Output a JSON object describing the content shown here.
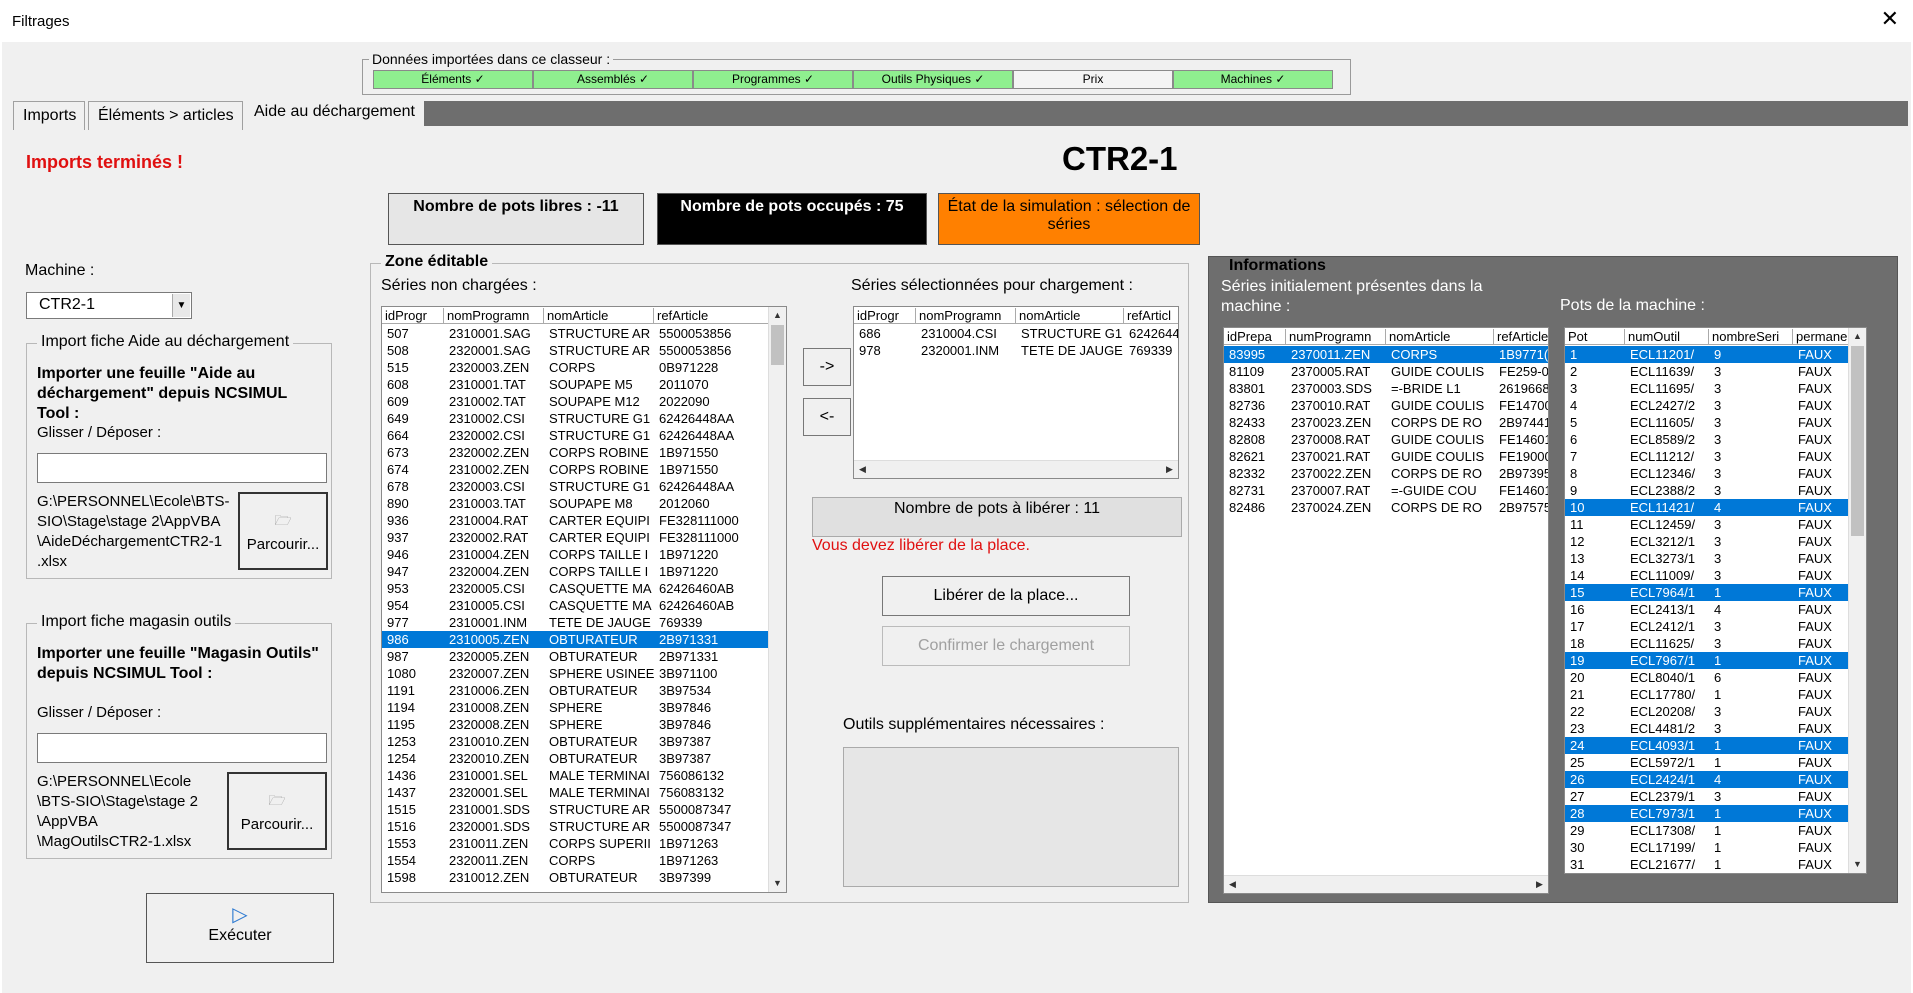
{
  "window": {
    "title": "Filtrages",
    "close": "✕"
  },
  "imported": {
    "label": "Données importées dans ce classeur :",
    "items": [
      {
        "label": "Éléments ✓",
        "color": "#8fef8f"
      },
      {
        "label": "Assemblés ✓",
        "color": "#8fef8f"
      },
      {
        "label": "Programmes ✓",
        "color": "#8fef8f"
      },
      {
        "label": "Outils Physiques ✓",
        "color": "#8fef8f"
      },
      {
        "label": "Prix",
        "color": "#f4f4f4"
      },
      {
        "label": "Machines ✓",
        "color": "#8fef8f"
      }
    ]
  },
  "tabs": [
    "Imports",
    "Éléments > articles",
    "Aide au déchargement"
  ],
  "status_msg": "Imports terminés !",
  "machine_name": "CTR2-1",
  "status": {
    "free": "Nombre de pots libres : -11",
    "occupied": "Nombre de pots occupés : 75",
    "simulation": "État de la simulation : sélection de séries"
  },
  "machine": {
    "label": "Machine :",
    "value": "CTR2-1"
  },
  "import_aide": {
    "title": "Import fiche Aide au déchargement",
    "heading": "Importer une feuille \"Aide au déchargement\" depuis NCSIMUL Tool :",
    "drop_label": "Glisser / Déposer :",
    "path": "G:\\PERSONNEL\\Ecole\\BTS-SIO\\Stage\\stage 2\\AppVBA\\AideDéchargementCTR2-1.xlsx",
    "path_lines": [
      "G:\\PERSONNEL\\Ecole\\BTS-",
      "SIO\\Stage\\stage 2\\AppVBA",
      "\\AideDéchargementCTR2-1",
      ".xlsx"
    ],
    "browse": "Parcourir..."
  },
  "import_mag": {
    "title": "Import fiche magasin outils",
    "heading": "Importer une feuille \"Magasin Outils\" depuis NCSIMUL Tool :",
    "drop_label": "Glisser / Déposer :",
    "path_lines": [
      "G:\\PERSONNEL\\Ecole",
      "\\BTS-SIO\\Stage\\stage 2",
      "\\AppVBA",
      "\\MagOutilsCTR2-1.xlsx"
    ],
    "browse": "Parcourir..."
  },
  "execute": "Exécuter",
  "zone": {
    "title": "Zone éditable",
    "unloaded_label": "Séries non chargées :",
    "selected_label": "Séries sélectionnées pour chargement :",
    "btn_add": "->",
    "btn_remove": "<-",
    "pots_to_free": "Nombre de pots à libérer : 11",
    "warning": "Vous devez libérer de la place.",
    "free_btn": "Libérer de la place...",
    "confirm_btn": "Confirmer le chargement",
    "extra_tools_label": "Outils supplémentaires nécessaires :"
  },
  "unloaded": {
    "headers": [
      "idProgr",
      "nomProgramn",
      "nomArticle",
      "refArticle"
    ],
    "rows": [
      [
        "507",
        "2310001.SAG",
        "STRUCTURE AR",
        "5500053856"
      ],
      [
        "508",
        "2320001.SAG",
        "STRUCTURE AR",
        "5500053856"
      ],
      [
        "515",
        "2320003.ZEN",
        "CORPS",
        "0B971228"
      ],
      [
        "608",
        "2310001.TAT",
        "SOUPAPE M5",
        "2011070"
      ],
      [
        "609",
        "2310002.TAT",
        "SOUPAPE M12",
        "2022090"
      ],
      [
        "649",
        "2310002.CSI",
        "STRUCTURE G1",
        "62426448AA"
      ],
      [
        "664",
        "2320002.CSI",
        "STRUCTURE G1",
        "62426448AA"
      ],
      [
        "673",
        "2320002.ZEN",
        "CORPS ROBINE",
        "1B971550"
      ],
      [
        "674",
        "2310002.ZEN",
        "CORPS ROBINE",
        "1B971550"
      ],
      [
        "678",
        "2320003.CSI",
        "STRUCTURE G1",
        "62426448AA"
      ],
      [
        "890",
        "2310003.TAT",
        "SOUPAPE M8",
        "2012060"
      ],
      [
        "936",
        "2310004.RAT",
        "CARTER EQUIPI",
        "FE328111000"
      ],
      [
        "937",
        "2320002.RAT",
        "CARTER EQUIPI",
        "FE328111000"
      ],
      [
        "946",
        "2310004.ZEN",
        "CORPS TAILLE I",
        "1B971220"
      ],
      [
        "947",
        "2320004.ZEN",
        "CORPS TAILLE I",
        "1B971220"
      ],
      [
        "953",
        "2320005.CSI",
        "CASQUETTE MA",
        "62426460AB"
      ],
      [
        "954",
        "2310005.CSI",
        "CASQUETTE MA",
        "62426460AB"
      ],
      [
        "977",
        "2310001.INM",
        "TETE DE JAUGE",
        "769339"
      ],
      [
        "986",
        "2310005.ZEN",
        "OBTURATEUR",
        "2B971331"
      ],
      [
        "987",
        "2320005.ZEN",
        "OBTURATEUR",
        "2B971331"
      ],
      [
        "1080",
        "2320007.ZEN",
        "SPHERE USINEE",
        "3B971100"
      ],
      [
        "1191",
        "2310006.ZEN",
        "OBTURATEUR",
        "3B97534"
      ],
      [
        "1194",
        "2310008.ZEN",
        "SPHERE",
        "3B97846"
      ],
      [
        "1195",
        "2320008.ZEN",
        "SPHERE",
        "3B97846"
      ],
      [
        "1253",
        "2310010.ZEN",
        "OBTURATEUR",
        "3B97387"
      ],
      [
        "1254",
        "2320010.ZEN",
        "OBTURATEUR",
        "3B97387"
      ],
      [
        "1436",
        "2310001.SEL",
        "MALE TERMINAI",
        "756086132"
      ],
      [
        "1437",
        "2320001.SEL",
        "MALE TERMINAI",
        "756083132"
      ],
      [
        "1515",
        "2310001.SDS",
        "STRUCTURE AR",
        "5500087347"
      ],
      [
        "1516",
        "2320001.SDS",
        "STRUCTURE AR",
        "5500087347"
      ],
      [
        "1553",
        "2310011.ZEN",
        "CORPS SUPERII",
        "1B971263"
      ],
      [
        "1554",
        "2320011.ZEN",
        "CORPS",
        "1B971263"
      ],
      [
        "1598",
        "2310012.ZEN",
        "OBTURATEUR",
        "3B97399"
      ]
    ],
    "selected_index": 18
  },
  "selected": {
    "headers": [
      "idProgr",
      "nomProgramn",
      "nomArticle",
      "refArticl"
    ],
    "rows": [
      [
        "686",
        "2310004.CSI",
        "STRUCTURE G1",
        "6242644"
      ],
      [
        "978",
        "2320001.INM",
        "TETE DE JAUGE",
        "769339"
      ]
    ]
  },
  "info": {
    "title": "Informations",
    "series_label": "Séries initialement présentes dans la machine :",
    "pots_label": "Pots de la machine :"
  },
  "initial_series": {
    "headers": [
      "idPrepa",
      "numProgramn",
      "nomArticle",
      "refArticle"
    ],
    "rows": [
      [
        "83995",
        "2370011.ZEN",
        "CORPS",
        "1B9771("
      ],
      [
        "81109",
        "2370005.RAT",
        "GUIDE COULIS",
        "FE259-0"
      ],
      [
        "83801",
        "2370003.SDS",
        "=-BRIDE L1",
        "2619668"
      ],
      [
        "82736",
        "2370010.RAT",
        "GUIDE COULIS",
        "FE14700"
      ],
      [
        "82433",
        "2370023.ZEN",
        "CORPS DE RO",
        "2B97441"
      ],
      [
        "82808",
        "2370008.RAT",
        "GUIDE COULIS",
        "FE14601"
      ],
      [
        "82621",
        "2370021.RAT",
        "GUIDE COULIS",
        "FE19000"
      ],
      [
        "82332",
        "2370022.ZEN",
        "CORPS DE RO",
        "2B97395"
      ],
      [
        "82731",
        "2370007.RAT",
        "=-GUIDE COU",
        "FE14601"
      ],
      [
        "82486",
        "2370024.ZEN",
        "CORPS DE RO",
        "2B97575"
      ]
    ],
    "selected_index": 0
  },
  "pots": {
    "headers": [
      "Pot",
      "numOutil",
      "nombreSeri",
      "permaner"
    ],
    "rows": [
      [
        "1",
        "ECL11201/",
        "9",
        "FAUX"
      ],
      [
        "2",
        "ECL11639/",
        "3",
        "FAUX"
      ],
      [
        "3",
        "ECL11695/",
        "3",
        "FAUX"
      ],
      [
        "4",
        "ECL2427/2",
        "3",
        "FAUX"
      ],
      [
        "5",
        "ECL11605/",
        "3",
        "FAUX"
      ],
      [
        "6",
        "ECL8589/2",
        "3",
        "FAUX"
      ],
      [
        "7",
        "ECL11212/",
        "3",
        "FAUX"
      ],
      [
        "8",
        "ECL12346/",
        "3",
        "FAUX"
      ],
      [
        "9",
        "ECL2388/2",
        "3",
        "FAUX"
      ],
      [
        "10",
        "ECL11421/",
        "4",
        "FAUX"
      ],
      [
        "11",
        "ECL12459/",
        "3",
        "FAUX"
      ],
      [
        "12",
        "ECL3212/1",
        "3",
        "FAUX"
      ],
      [
        "13",
        "ECL3273/1",
        "3",
        "FAUX"
      ],
      [
        "14",
        "ECL11009/",
        "3",
        "FAUX"
      ],
      [
        "15",
        "ECL7964/1",
        "1",
        "FAUX"
      ],
      [
        "16",
        "ECL2413/1",
        "4",
        "FAUX"
      ],
      [
        "17",
        "ECL2412/1",
        "3",
        "FAUX"
      ],
      [
        "18",
        "ECL11625/",
        "3",
        "FAUX"
      ],
      [
        "19",
        "ECL7967/1",
        "1",
        "FAUX"
      ],
      [
        "20",
        "ECL8040/1",
        "6",
        "FAUX"
      ],
      [
        "21",
        "ECL17780/",
        "1",
        "FAUX"
      ],
      [
        "22",
        "ECL20208/",
        "3",
        "FAUX"
      ],
      [
        "23",
        "ECL4481/2",
        "3",
        "FAUX"
      ],
      [
        "24",
        "ECL4093/1",
        "1",
        "FAUX"
      ],
      [
        "25",
        "ECL5972/1",
        "1",
        "FAUX"
      ],
      [
        "26",
        "ECL2424/1",
        "4",
        "FAUX"
      ],
      [
        "27",
        "ECL2379/1",
        "3",
        "FAUX"
      ],
      [
        "28",
        "ECL7973/1",
        "1",
        "FAUX"
      ],
      [
        "29",
        "ECL17308/",
        "1",
        "FAUX"
      ],
      [
        "30",
        "ECL17199/",
        "1",
        "FAUX"
      ],
      [
        "31",
        "ECL21677/",
        "1",
        "FAUX"
      ]
    ],
    "selected_indices": [
      0,
      9,
      14,
      18,
      23,
      25,
      27
    ]
  },
  "icons": {
    "folder": "folder-open-icon",
    "play": "play-icon",
    "dropdown": "chevron-down-icon"
  }
}
